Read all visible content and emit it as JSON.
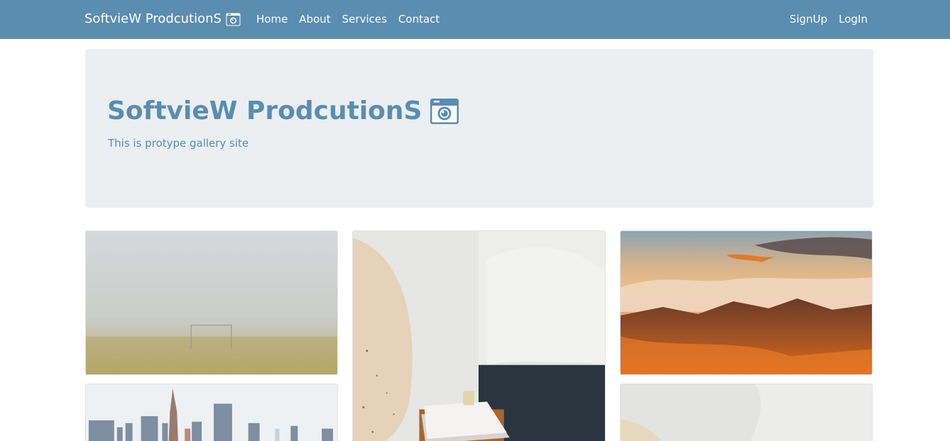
{
  "navbar": {
    "brand": "SoftvieW ProdcutionS",
    "brand_icon": "camera-icon",
    "left_links": [
      "Home",
      "About",
      "Services",
      "Contact"
    ],
    "right_links": [
      "SignUp",
      "LogIn"
    ],
    "bg_color": "#5a8db0"
  },
  "hero": {
    "title": "SoftvieW ProdcutionS",
    "title_icon": "camera-icon",
    "subtitle": "This is protype gallery site",
    "bg_color": "#ebeff1"
  },
  "gallery": {
    "images": [
      {
        "name": "foggy-field-photo"
      },
      {
        "name": "bedroom-vase-photo"
      },
      {
        "name": "mountain-sunset-photo"
      },
      {
        "name": "city-skyline-photo"
      },
      {
        "name": "bedroom-vase-photo-2"
      }
    ]
  }
}
